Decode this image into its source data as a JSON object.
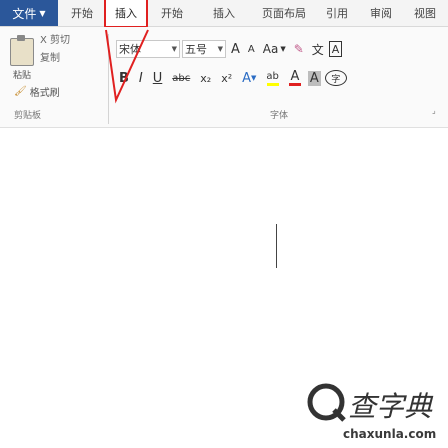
{
  "menubar": {
    "file_tab": "文件",
    "tabs": [
      "开始",
      "插入",
      "页面布局",
      "引用",
      "审阅",
      "视图"
    ],
    "left_tab": "开始",
    "highlighted_tab": "插入"
  },
  "clipboard": {
    "paste_label": "粘贴",
    "cut": "X 剪切",
    "copy": "复制",
    "format_painter": "格式刷",
    "group_label": "剪贴板"
  },
  "font": {
    "font_name": "宋体",
    "font_size": "五号",
    "grow": "A",
    "shrink": "A",
    "case_label": "Aa",
    "clear_format": "✎",
    "phonetic": "文",
    "border_char": "A",
    "bold": "B",
    "italic": "I",
    "underline": "U",
    "strike": "abc",
    "subscript": "x₂",
    "superscript": "x²",
    "effects": "A",
    "highlight": "ab",
    "font_color": "A",
    "char_shade": "A",
    "enclose": "字",
    "group_label": "字体"
  },
  "colors": {
    "accent": "#2b579a",
    "callout": "#e02020",
    "font_color_bar": "#e02020",
    "highlight_bar": "#ffff00"
  },
  "watermark": {
    "chars": "查字典",
    "domain": "chaxunla.com"
  }
}
